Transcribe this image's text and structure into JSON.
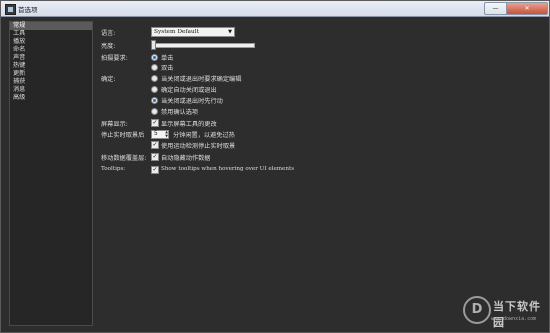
{
  "window": {
    "title": "首选项",
    "minimize_glyph": "—",
    "close_glyph": "✕"
  },
  "sidebar": {
    "items": [
      {
        "label": "常规",
        "active": true
      },
      {
        "label": "工具"
      },
      {
        "label": "播放"
      },
      {
        "label": "命名"
      },
      {
        "label": "声音"
      },
      {
        "label": "热键"
      },
      {
        "label": "更新"
      },
      {
        "label": "捕获"
      },
      {
        "label": "消息"
      },
      {
        "label": "高级"
      }
    ]
  },
  "general": {
    "language_label": "语言:",
    "language_value": "System Default",
    "brightness_label": "亮度:",
    "brightness_level": 0.0,
    "shot_label": "拍摄要求:",
    "shot_options": [
      {
        "label": "单击",
        "checked": true
      },
      {
        "label": "双击",
        "checked": false
      }
    ],
    "confirm_label": "确定:",
    "confirm_options": [
      {
        "label": "当关闭或退出时要求确定编辑",
        "checked": false
      },
      {
        "label": "确定自动关闭或退出",
        "checked": false
      },
      {
        "label": "当关闭或退出时先行动",
        "checked": true
      },
      {
        "label": "禁用确认选项",
        "checked": false
      }
    ],
    "screen_label": "屏幕显示:",
    "screen_check": "显示屏幕工具的更改",
    "stop_label": "停止实时取景后",
    "stop_value": "5",
    "stop_suffix": "分钟闲置，以避免过热",
    "motion_check": "使用运动检测停止实时取景",
    "mobile_label": "移动数据覆盖层:",
    "mobile_check": "自动隐藏动作数据",
    "tooltips_label": "Tooltips:",
    "tooltips_check": "Show tooltips when hovering over UI elements"
  },
  "watermark": {
    "logo": "D",
    "name": "当下软件园",
    "url": "www.downxia.com"
  }
}
